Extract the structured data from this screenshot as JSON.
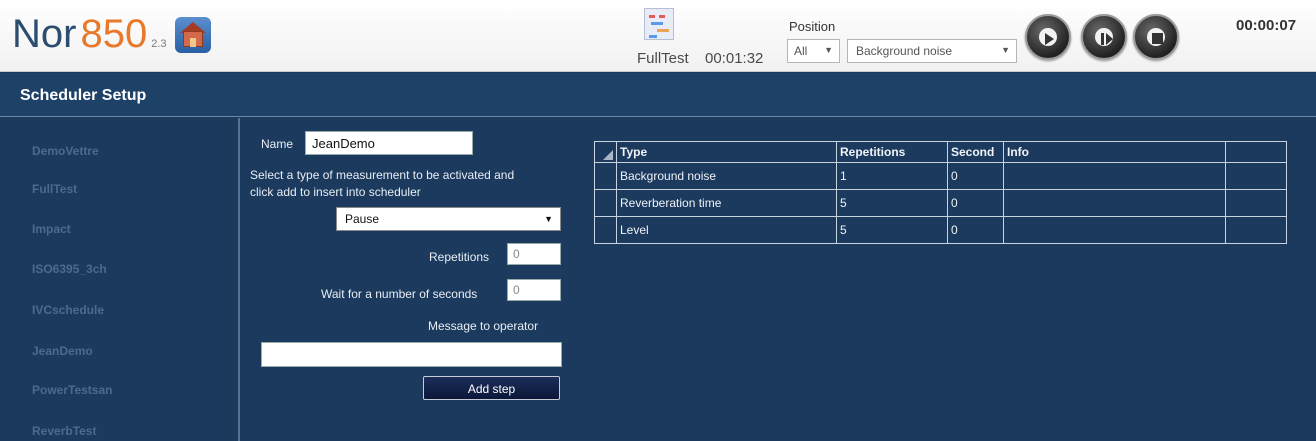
{
  "app": {
    "name_part1": "Nor",
    "name_part2": "850",
    "version": "2.3"
  },
  "header": {
    "test_name": "FullTest",
    "test_time": "00:01:32",
    "position_label": "Position",
    "position_selected": "All",
    "measurement_selected": "Background noise",
    "timer": "00:00:07"
  },
  "page": {
    "title": "Scheduler Setup"
  },
  "sidebar": {
    "items": [
      "DemoVettre",
      "FullTest",
      "Impact",
      "ISO6395_3ch",
      "IVCschedule",
      "JeanDemo",
      "PowerTestsan",
      "ReverbTest"
    ]
  },
  "form": {
    "name_label": "Name",
    "name_value": "JeanDemo",
    "instruction_line1": "Select a type of measurement to be activated and",
    "instruction_line2": "click add to insert into scheduler",
    "type_selected": "Pause",
    "repetitions_label": "Repetitions",
    "repetitions_value": "0",
    "wait_label": "Wait for a number of seconds",
    "wait_value": "0",
    "message_label": "Message to operator",
    "message_value": "",
    "add_button": "Add step"
  },
  "table": {
    "headers": [
      "Type",
      "Repetitions",
      "Second",
      "Info"
    ],
    "rows": [
      [
        "Background noise",
        "1",
        "0",
        ""
      ],
      [
        "Reverberation time",
        "5",
        "0",
        ""
      ],
      [
        "Level",
        "5",
        "0",
        ""
      ]
    ]
  }
}
